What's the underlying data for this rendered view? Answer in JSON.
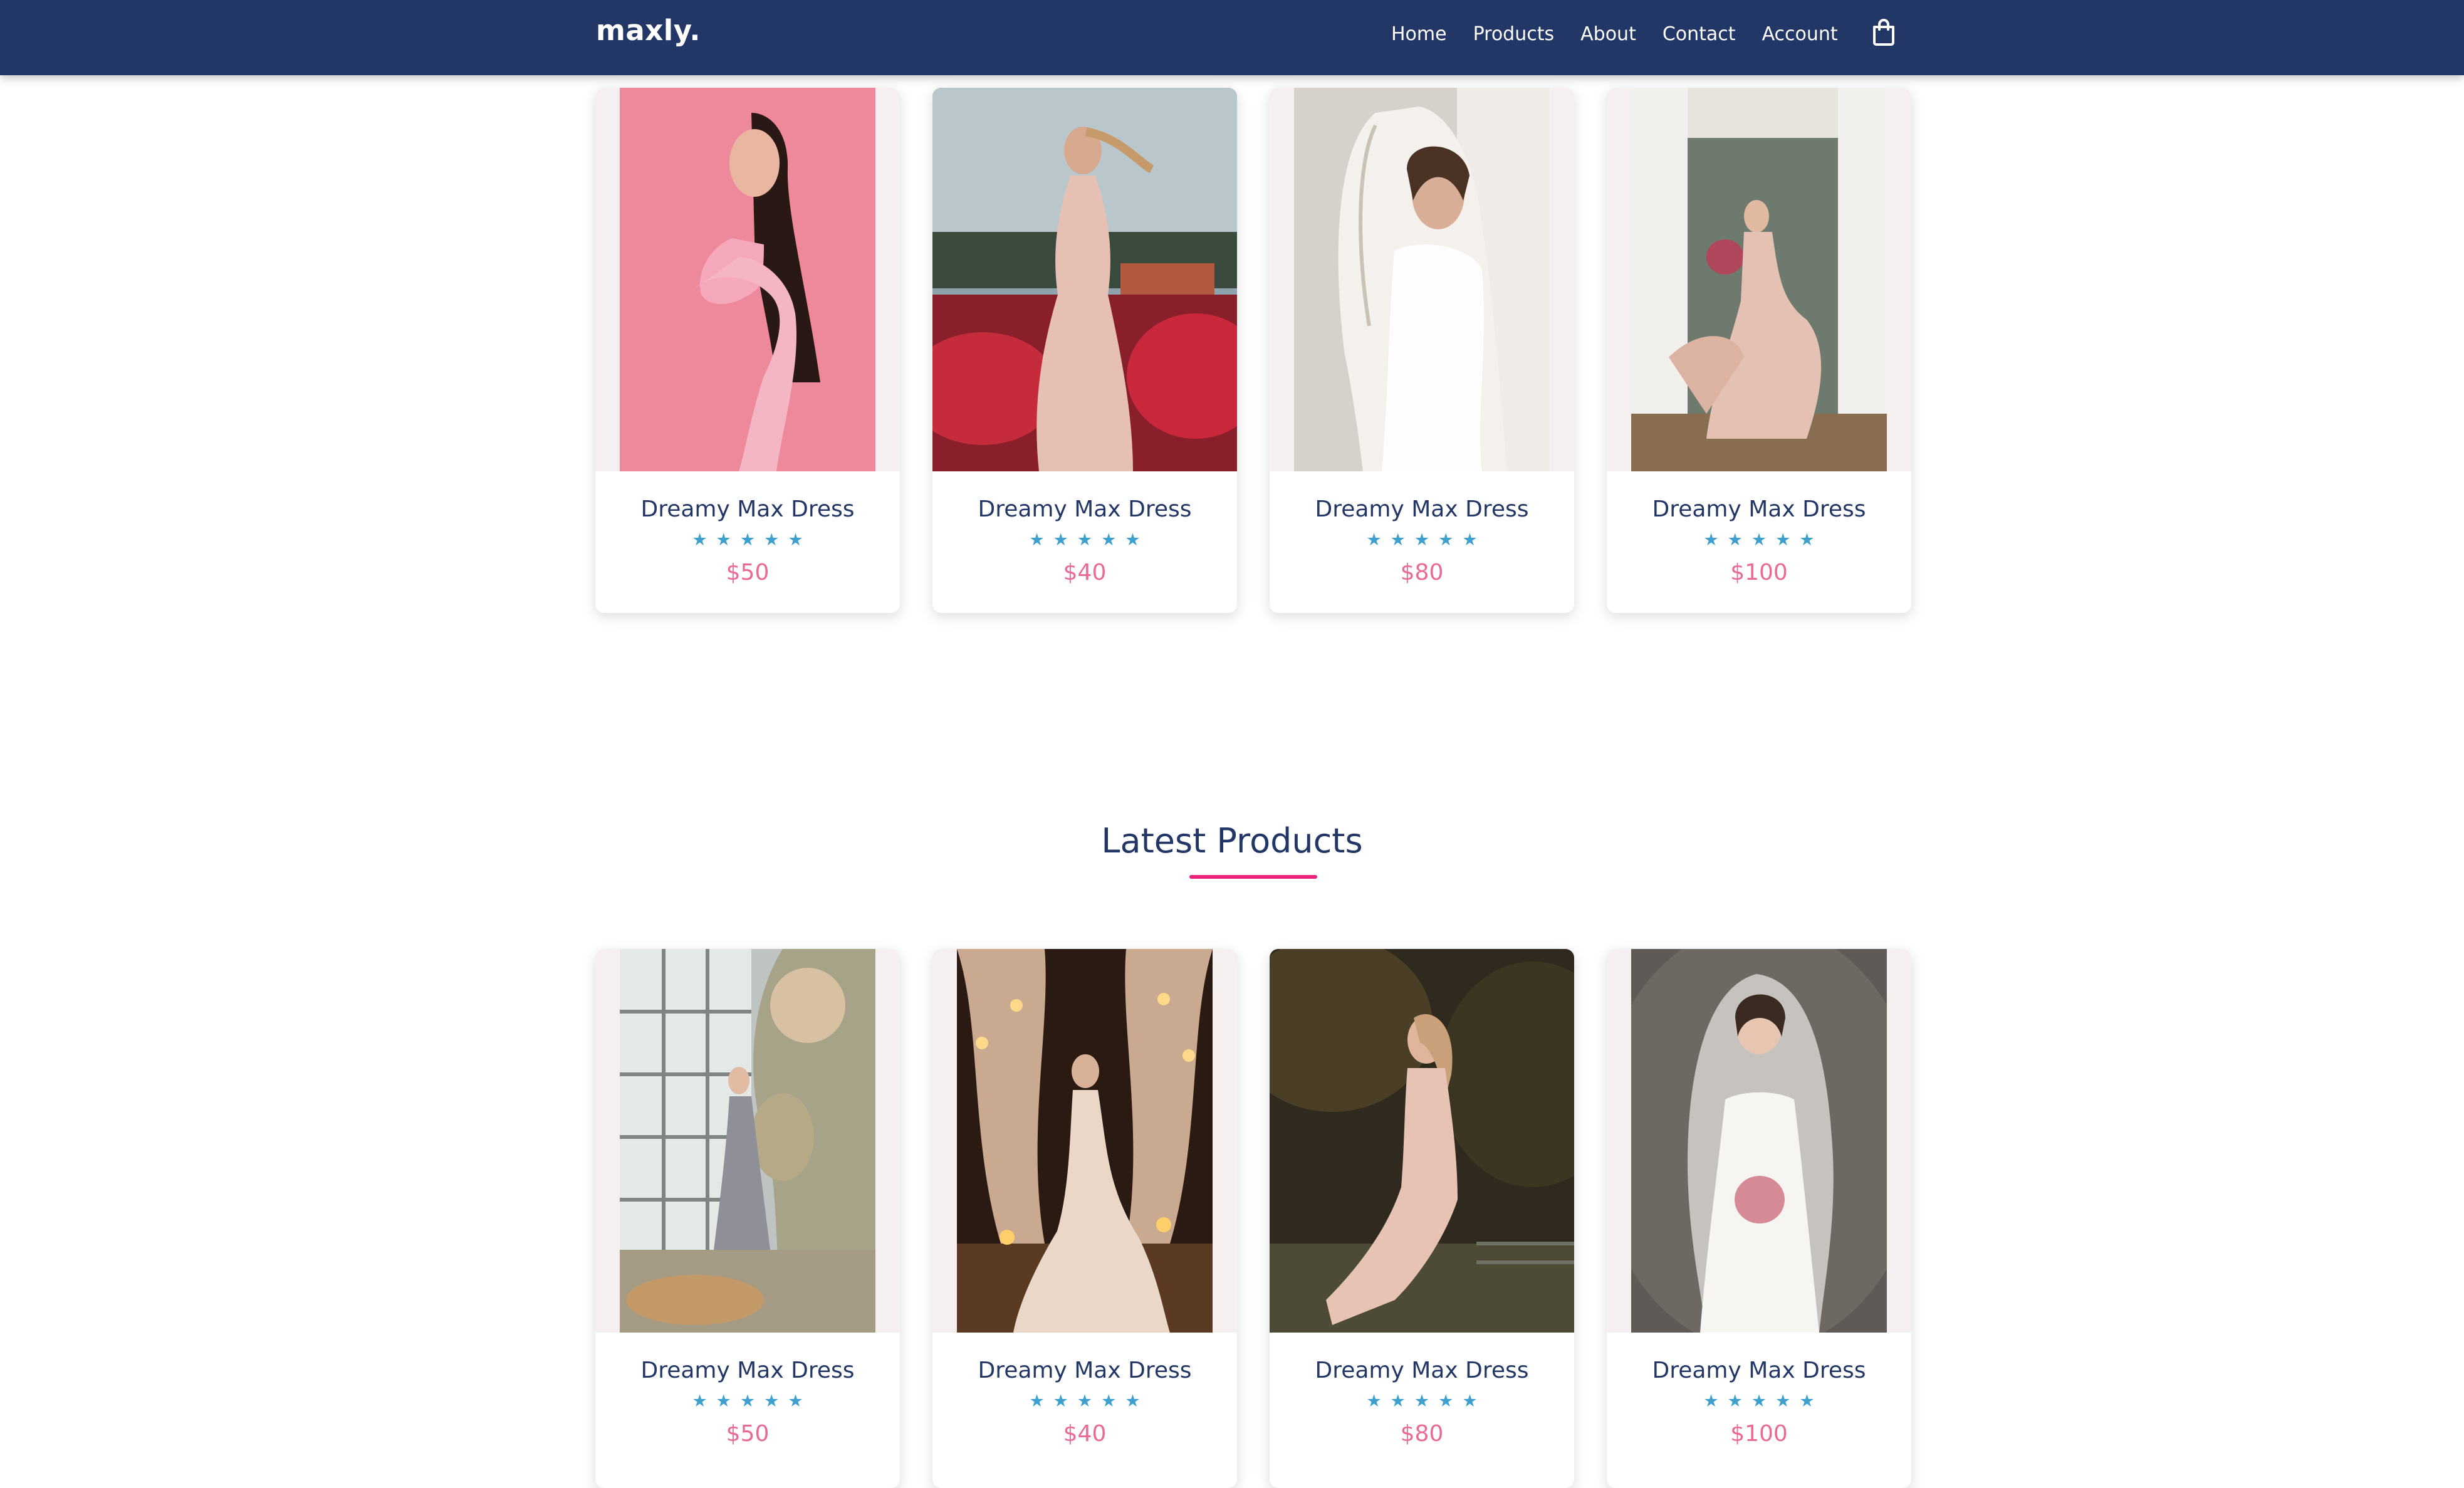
{
  "brand": {
    "logo_text": "maxly."
  },
  "nav": {
    "links": [
      "Home",
      "Products",
      "About",
      "Contact",
      "Account"
    ],
    "cart_icon": "shopping-bag-icon"
  },
  "colors": {
    "navbar": "#233767",
    "product_name": "#233767",
    "star": "#3ea0cf",
    "price": "#ea6a94",
    "title_underline": "#e7237a"
  },
  "featured_products": [
    {
      "name": "Dreamy Max Dress",
      "rating": 5,
      "price": "$50"
    },
    {
      "name": "Dreamy Max Dress",
      "rating": 5,
      "price": "$40"
    },
    {
      "name": "Dreamy Max Dress",
      "rating": 5,
      "price": "$80"
    },
    {
      "name": "Dreamy Max Dress",
      "rating": 5,
      "price": "$100"
    }
  ],
  "latest_section": {
    "title": "Latest Products"
  },
  "latest_products": [
    {
      "name": "Dreamy Max Dress",
      "rating": 5,
      "price": "$50"
    },
    {
      "name": "Dreamy Max Dress",
      "rating": 5,
      "price": "$40"
    },
    {
      "name": "Dreamy Max Dress",
      "rating": 5,
      "price": "$80"
    },
    {
      "name": "Dreamy Max Dress",
      "rating": 5,
      "price": "$100"
    }
  ]
}
